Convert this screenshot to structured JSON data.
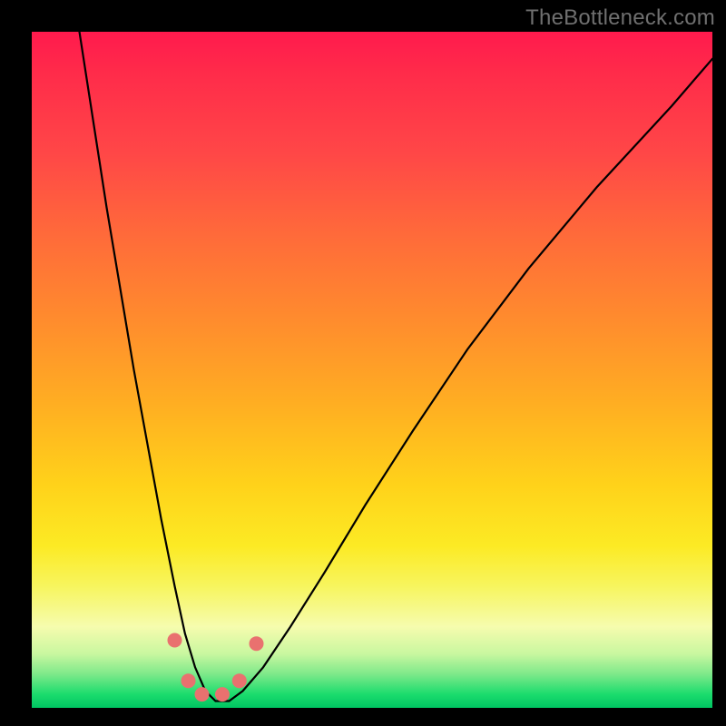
{
  "watermark": "TheBottleneck.com",
  "gradient": {
    "top": "#ff1a4d",
    "mid_orange": "#ff8a2e",
    "mid_yellow": "#ffd21a",
    "pale": "#f6fcae",
    "green": "#00c562"
  },
  "chart_data": {
    "type": "line",
    "title": "",
    "xlabel": "",
    "ylabel": "",
    "xlim": [
      0,
      100
    ],
    "ylim": [
      0,
      100
    ],
    "grid": false,
    "series": [
      {
        "name": "bottleneck-curve",
        "x": [
          7,
          9,
          11,
          13,
          15,
          17,
          19,
          21,
          22.5,
          24,
          25.5,
          27,
          29,
          31,
          34,
          38,
          43,
          49,
          56,
          64,
          73,
          83,
          94,
          100
        ],
        "y": [
          100,
          87,
          74,
          62,
          50,
          39,
          28,
          18,
          11,
          6,
          2.5,
          1,
          1,
          2.5,
          6,
          12,
          20,
          30,
          41,
          53,
          65,
          77,
          89,
          96
        ]
      }
    ],
    "markers": [
      {
        "name": "marker-left-upper",
        "x": 21.0,
        "y": 10.0
      },
      {
        "name": "marker-left-lower",
        "x": 23.0,
        "y": 4.0
      },
      {
        "name": "marker-trough-1",
        "x": 25.0,
        "y": 2.0
      },
      {
        "name": "marker-trough-2",
        "x": 28.0,
        "y": 2.0
      },
      {
        "name": "marker-right-lower",
        "x": 30.5,
        "y": 4.0
      },
      {
        "name": "marker-right-upper",
        "x": 33.0,
        "y": 9.5
      }
    ],
    "marker_color": "#e9716f"
  }
}
